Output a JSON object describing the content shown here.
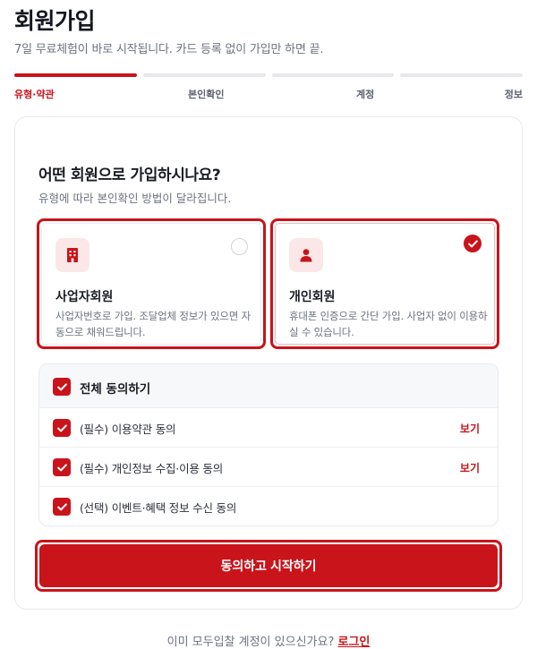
{
  "header": {
    "title": "회원가입",
    "subtitle": "7일 무료체험이 바로 시작됩니다. 카드 등록 없이 가입만 하면 끝."
  },
  "steps": {
    "current": 1,
    "total": 4,
    "labels": [
      "유형·약관",
      "본인확인",
      "계정",
      "정보"
    ]
  },
  "question": {
    "title": "어떤 회원으로 가입하시나요?",
    "description": "유형에 따라 본인확인 방법이 달라집니다."
  },
  "member_types": [
    {
      "name": "사업자회원",
      "description": "사업자번호로 가입. 조달업체 정보가 있으면 자동으로 채워드립니다.",
      "icon": "building-icon",
      "selected": false
    },
    {
      "name": "개인회원",
      "description": "휴대폰 인증으로 간단 가입. 사업자 없이 이용하실 수 있습니다.",
      "icon": "person-icon",
      "selected": true
    }
  ],
  "agreements": {
    "all_label": "전체 동의하기",
    "view_label": "보기",
    "items": [
      {
        "label": "(필수) 이용약관 동의",
        "checked": true
      },
      {
        "label": "(필수) 개인정보 수집·이용 동의",
        "checked": true
      },
      {
        "label": "(선택) 이벤트·혜택 정보 수신 동의",
        "checked": true
      }
    ]
  },
  "cta": {
    "label": "동의하고 시작하기"
  },
  "footer": {
    "prompt": "이미 모두입찰 계정이 있으신가요?",
    "login_label": "로그인"
  },
  "colors": {
    "accent": "#c8141a",
    "muted": "#6b7280",
    "border": "#e7e9ee"
  }
}
